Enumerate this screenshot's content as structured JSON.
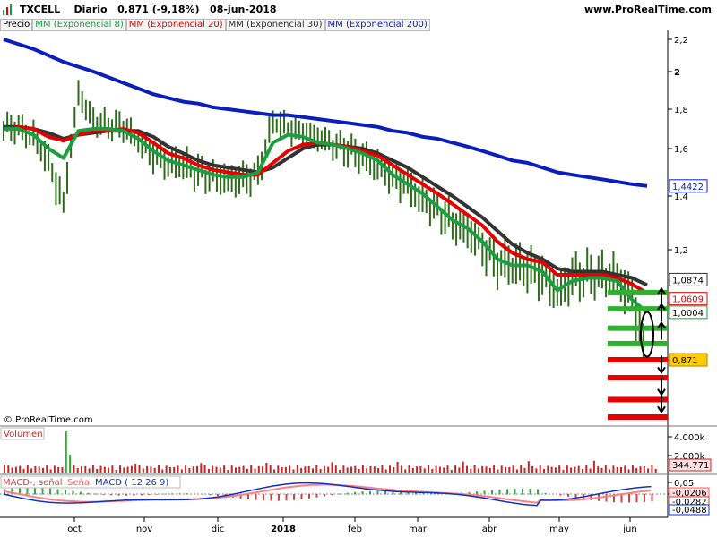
{
  "header": {
    "ticker": "TXCELL",
    "period": "Diario",
    "last": "0,871",
    "change": "(-9,18%)",
    "date": "08-jun-2018",
    "brand": "www.ProRealTime.com"
  },
  "legend": {
    "price": "Precio",
    "ema8": "MM (Exponencial 8)",
    "ema20": "MM (Exponencial 20)",
    "ema30": "MM (Exponencial 30)",
    "ema200": "MM (Exponencial 200)"
  },
  "colors": {
    "ema8": "#1a9e40",
    "ema20": "#e60000",
    "ema30": "#333333",
    "ema200": "#0a1ebe",
    "bar": "#2e6b1a",
    "green_level": "#2fb02f",
    "red_level": "#e60000",
    "volume": "#cc2222",
    "volume_spike": "#2fb02f",
    "macd": "#1030cc",
    "signal": "#ff8080"
  },
  "copyright": "© ProRealTime.com",
  "price_axis": {
    "ticks": [
      "2,2",
      "2",
      "1,8",
      "1,6",
      "1,4",
      "1,2"
    ],
    "tags": {
      "ema200": "1,4422",
      "ema30": "1,0874",
      "ema20": "1,0609",
      "ema8": "1,0004",
      "last": "0,871"
    }
  },
  "volume_panel": {
    "label": "Volumen",
    "ticks": [
      "4.000k",
      "2.000k"
    ],
    "last_tag": "344.771"
  },
  "macd_panel": {
    "label_main": "MACD-, señal",
    "label_signal": "Señal",
    "label_macd": "MACD ( 12 26 9)",
    "ticks": [
      "0,05",
      "0"
    ],
    "tags": {
      "signal": "-0,0206",
      "macd_hist": "-0,0282",
      "macd": "-0,0488"
    }
  },
  "x_axis": {
    "labels": [
      "oct",
      "nov",
      "dic",
      "2018",
      "feb",
      "mar",
      "abr",
      "may",
      "jun"
    ]
  },
  "chart_data": {
    "type": "line",
    "title": "TXCELL Diario 0,871 (-9,18%) 08-jun-2018",
    "xlabel": "",
    "ylabel": "",
    "ylim": [
      0.8,
      2.3
    ],
    "months": [
      "oct",
      "nov",
      "dic",
      "2018",
      "feb",
      "mar",
      "abr",
      "may",
      "jun"
    ],
    "series": [
      {
        "name": "Precio",
        "values": [
          1.71,
          1.7,
          1.66,
          1.55,
          1.36,
          1.88,
          1.74,
          1.72,
          1.71,
          1.64,
          1.58,
          1.54,
          1.53,
          1.5,
          1.48,
          1.47,
          1.47,
          1.49,
          1.74,
          1.7,
          1.68,
          1.66,
          1.62,
          1.6,
          1.56,
          1.53,
          1.48,
          1.44,
          1.39,
          1.35,
          1.3,
          1.27,
          1.21,
          1.16,
          1.15,
          1.14,
          1.12,
          1.06,
          1.11,
          1.12,
          1.12,
          1.11,
          1.04,
          0.871
        ]
      },
      {
        "name": "MM (Exponencial 8)",
        "values": [
          1.7,
          1.7,
          1.67,
          1.6,
          1.56,
          1.69,
          1.7,
          1.7,
          1.69,
          1.65,
          1.59,
          1.55,
          1.53,
          1.51,
          1.49,
          1.48,
          1.48,
          1.5,
          1.63,
          1.67,
          1.66,
          1.63,
          1.62,
          1.6,
          1.58,
          1.55,
          1.49,
          1.45,
          1.41,
          1.36,
          1.31,
          1.28,
          1.23,
          1.17,
          1.15,
          1.15,
          1.13,
          1.07,
          1.1,
          1.11,
          1.11,
          1.1,
          1.04,
          1.0004
        ]
      },
      {
        "name": "MM (Exponencial 20)",
        "values": [
          1.7,
          1.71,
          1.7,
          1.66,
          1.64,
          1.67,
          1.69,
          1.69,
          1.7,
          1.68,
          1.63,
          1.58,
          1.56,
          1.53,
          1.51,
          1.5,
          1.49,
          1.49,
          1.54,
          1.59,
          1.62,
          1.63,
          1.62,
          1.61,
          1.59,
          1.57,
          1.53,
          1.49,
          1.45,
          1.41,
          1.37,
          1.33,
          1.29,
          1.23,
          1.19,
          1.17,
          1.16,
          1.12,
          1.12,
          1.12,
          1.12,
          1.11,
          1.09,
          1.0609
        ]
      },
      {
        "name": "MM (Exponencial 30)",
        "values": [
          1.71,
          1.71,
          1.7,
          1.68,
          1.65,
          1.67,
          1.68,
          1.69,
          1.69,
          1.69,
          1.66,
          1.61,
          1.58,
          1.55,
          1.53,
          1.52,
          1.51,
          1.5,
          1.52,
          1.56,
          1.6,
          1.62,
          1.62,
          1.61,
          1.6,
          1.58,
          1.55,
          1.52,
          1.48,
          1.44,
          1.4,
          1.36,
          1.32,
          1.27,
          1.22,
          1.19,
          1.17,
          1.14,
          1.13,
          1.13,
          1.13,
          1.12,
          1.11,
          1.0874
        ]
      },
      {
        "name": "MM (Exponencial 200)",
        "values": [
          2.2,
          2.17,
          2.14,
          2.1,
          2.06,
          2.03,
          2.0,
          1.97,
          1.94,
          1.91,
          1.88,
          1.86,
          1.84,
          1.83,
          1.81,
          1.8,
          1.79,
          1.78,
          1.77,
          1.77,
          1.76,
          1.75,
          1.74,
          1.73,
          1.72,
          1.71,
          1.69,
          1.68,
          1.66,
          1.65,
          1.63,
          1.61,
          1.59,
          1.57,
          1.55,
          1.54,
          1.52,
          1.5,
          1.49,
          1.48,
          1.47,
          1.46,
          1.45,
          1.4422
        ]
      }
    ],
    "levels_green": [
      1.063,
      1.011,
      0.957,
      0.915
    ],
    "levels_red": [
      0.871,
      0.83,
      0.78,
      0.74
    ]
  }
}
